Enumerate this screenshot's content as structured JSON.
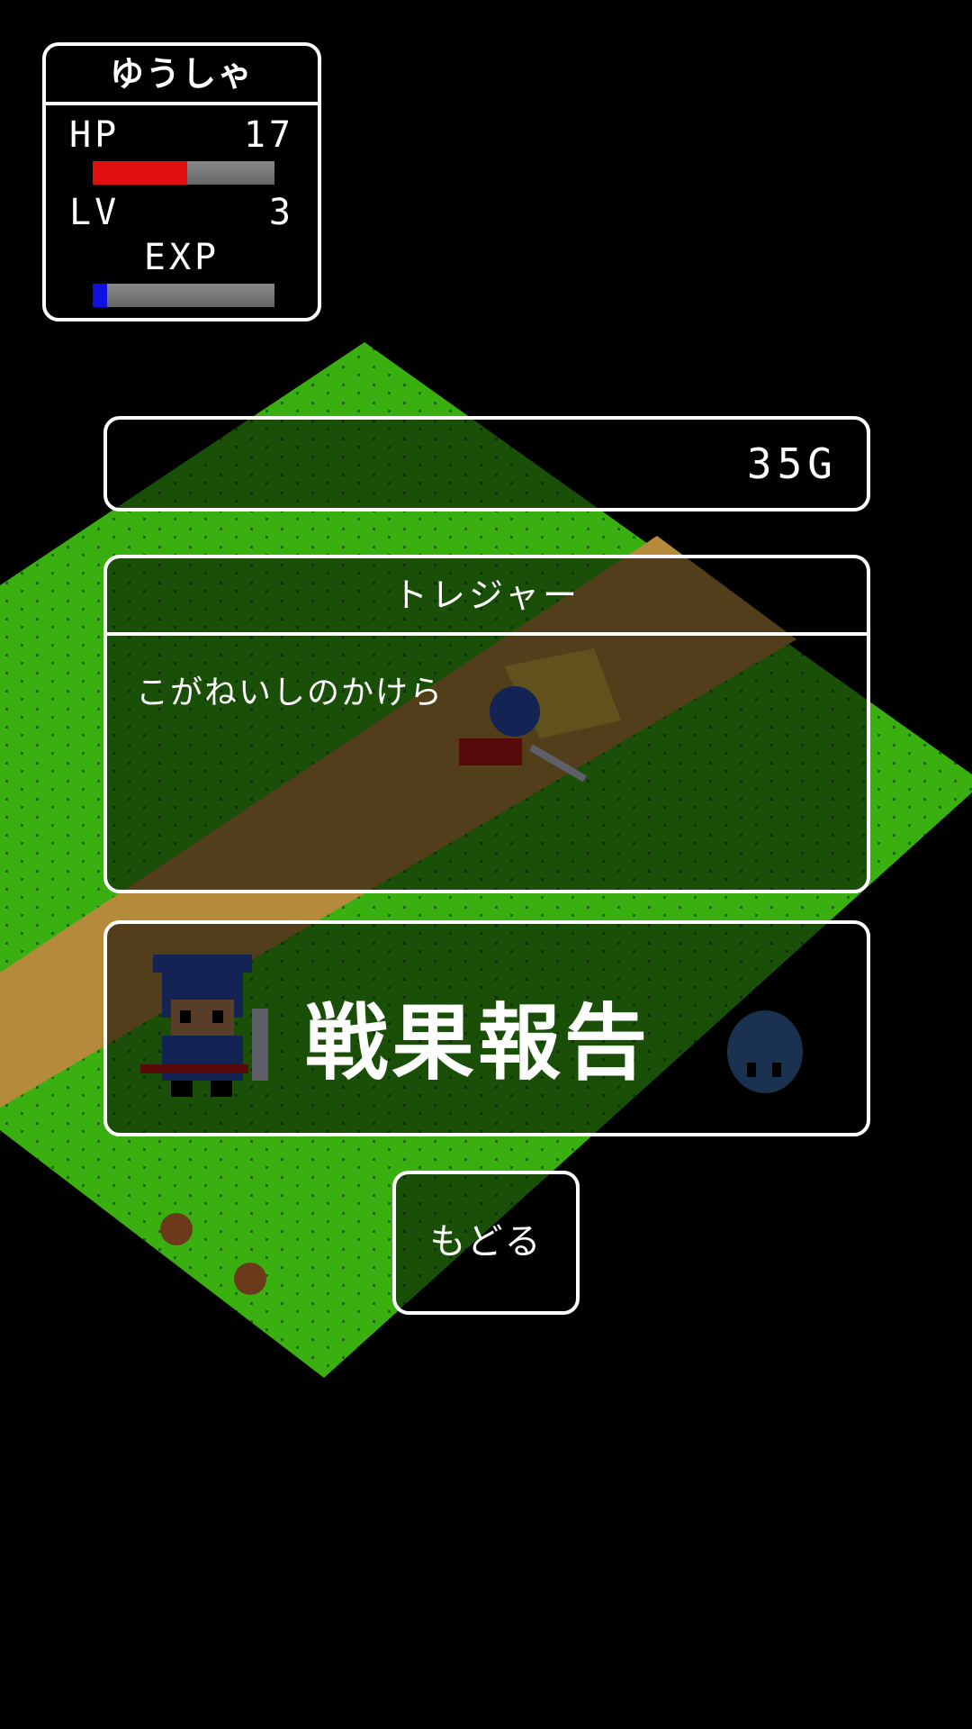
{
  "status": {
    "name": "ゆうしゃ",
    "hp_label": "HP",
    "hp_value": "17",
    "hp_fraction": 0.52,
    "lv_label": "LV",
    "lv_value": "3",
    "exp_label": "EXP",
    "exp_fraction": 0.08
  },
  "gold": {
    "amount": "35G"
  },
  "treasure": {
    "heading": "トレジャー",
    "item": "こがねいしのかけら"
  },
  "report": {
    "title": "戦果報告"
  },
  "back_button": {
    "label": "もどる"
  },
  "colors": {
    "grass": "#3ab010",
    "path": "#b58a3a",
    "hp_bar": "#e01010",
    "exp_bar": "#1010e0"
  }
}
